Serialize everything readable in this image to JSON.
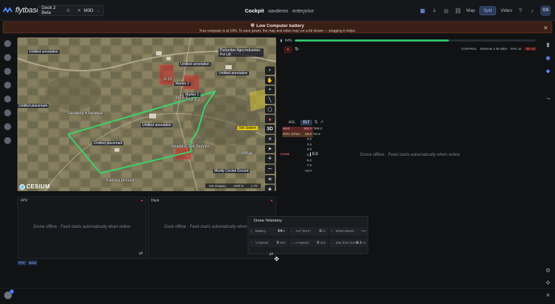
{
  "app": {
    "brand": "flytbase",
    "device": "Dock 2 Beta",
    "device_model": "M3D",
    "page": "Cockpit",
    "org": "uavdemo",
    "plan": "enterprise"
  },
  "view_toggle": {
    "map": "Map",
    "split": "Split",
    "video": "Video",
    "active": "Split"
  },
  "user": {
    "initials": "GS"
  },
  "banner": {
    "title": "Low Computer battery",
    "desc": "Your computer is at 19%. To save power, the map and video may run a bit slower — plugging in helps."
  },
  "map": {
    "labels": {
      "l1": "Purlumber Agro-industries Pvt Ltd",
      "l2": "Untitled annotation",
      "l3": "Untitled annotation",
      "l4": "Untitled annotation",
      "l5": "Sandeep Khanekar",
      "l6": "Untitled annotation",
      "l7": "Marker 1",
      "l8": "Marker 2",
      "l9": "Anand P Pet Service",
      "l10": "Kakriya prosed",
      "l11": "Vitthal",
      "l12": "Mostly Cricket Ground",
      "l13": "Untitled placemark",
      "l14": "Site Station",
      "l15": "A 20",
      "l16": "NFZ 1",
      "l17": "NFZ 2",
      "l18": "Untitled placemark"
    },
    "tools": {
      "threed": "3D",
      "plus": "+",
      "minus": "−"
    },
    "cesium": "CESIUM",
    "scale": [
      "Get Imagery",
      "1000 m",
      "1.7S"
    ]
  },
  "right": {
    "signal_pct": "64%",
    "signal_fraction": 0.64,
    "control": "CONTROL",
    "ethernet": "Ethernet 4.36 Mb/s",
    "rtk": "RTK 42",
    "rtk_badge": "RF 3d",
    "offline": "Drone offline · Feed starts automatically when online"
  },
  "altitude": {
    "tab_agl": "AGL",
    "tab_rlt": "RLT",
    "max_label": "MAX",
    "max_val": "300.0",
    "rth_label": "RTH, GTSA",
    "rth_val": "56.8",
    "ticks": [
      "*300.0",
      "*54.9",
      "5.0",
      "2.5",
      "0.0",
      "-2.5",
      "-5.0",
      "-7.5",
      "-10.0"
    ],
    "current": "0.0",
    "home": "HOME"
  },
  "feeds": {
    "fpv_title": "FPV",
    "dock_title": "Dock",
    "offline": "Drone offline · Feed starts automatically when online",
    "dock_offline": "Dock offline · Feed starts automatically when online",
    "tabs": [
      "FPV",
      "Dock"
    ]
  },
  "telemetry": {
    "title": "Drone Telemetry",
    "cells": [
      {
        "label": "Battery",
        "value": "64",
        "unit": "%"
      },
      {
        "label": "ALT (RLT)",
        "value": "0",
        "unit": "m"
      },
      {
        "label": "Wind Speed",
        "value": "—",
        "unit": ""
      },
      {
        "label": "V-Speed",
        "value": "0",
        "unit": "m/s"
      },
      {
        "label": "H-Speed",
        "value": "0",
        "unit": "m/s"
      },
      {
        "label": "Dist from home",
        "value": "0.1",
        "unit": "m"
      }
    ]
  },
  "help_count": "1"
}
